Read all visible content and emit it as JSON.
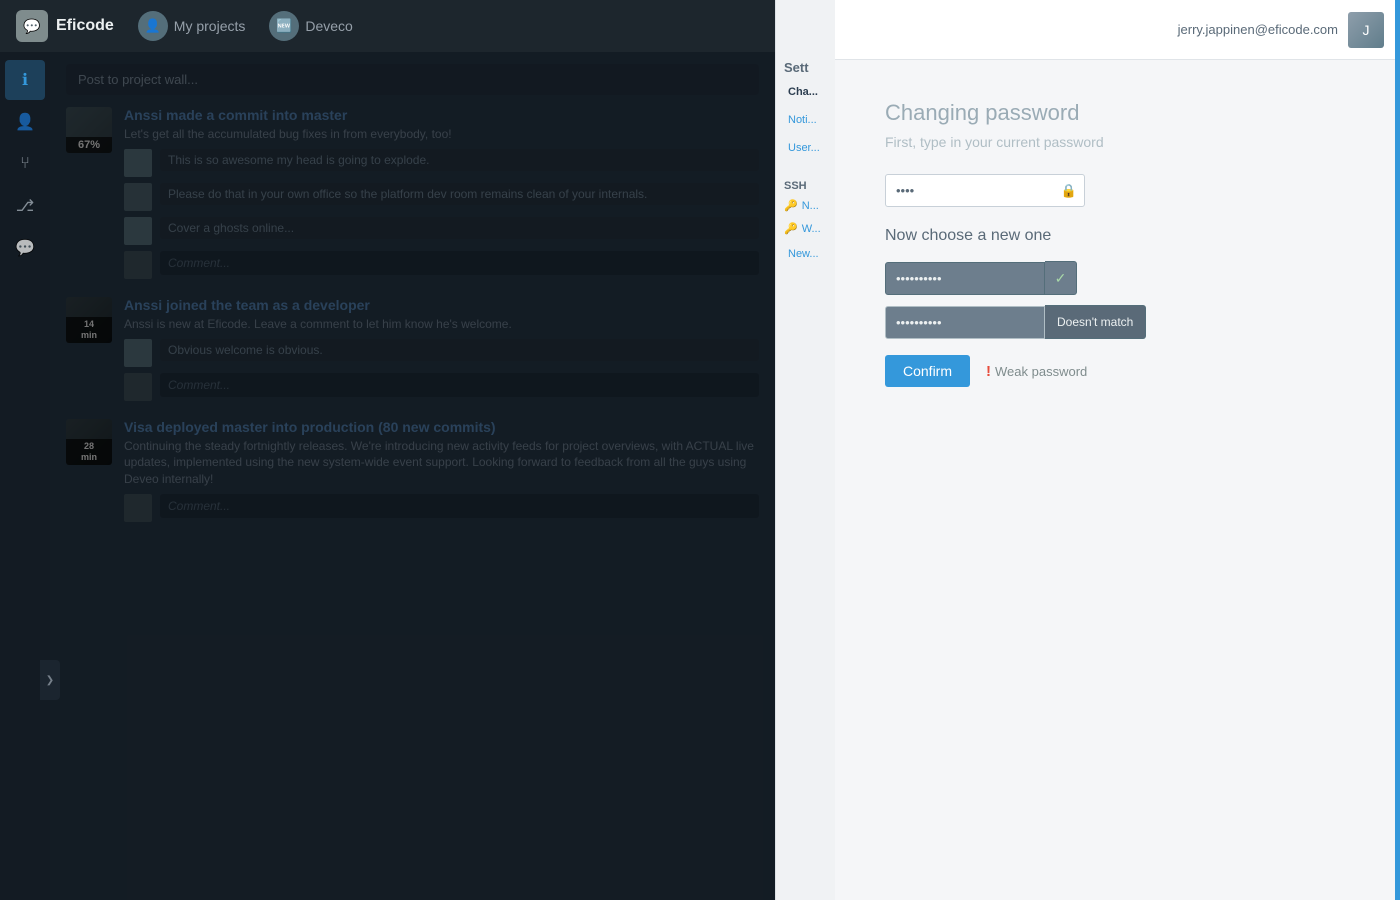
{
  "app": {
    "name": "Eficode",
    "nav": {
      "logo_icon": "💬",
      "items": [
        {
          "label": "My projects",
          "icon": "👤"
        },
        {
          "label": "Deveco",
          "icon": "🆕"
        }
      ]
    }
  },
  "sidebar": {
    "items": [
      {
        "label": "info",
        "icon": "ℹ",
        "active": true
      },
      {
        "label": "user",
        "icon": "👤"
      },
      {
        "label": "branch",
        "icon": "⑂"
      },
      {
        "label": "git",
        "icon": "⎇"
      },
      {
        "label": "chat",
        "icon": "💬"
      }
    ],
    "toggle_icon": "❯"
  },
  "activities": [
    {
      "id": 1,
      "title": "Anssi made a commit into master",
      "desc": "Let's get all the accumulated bug fixes in from everybody, too!",
      "time": "67%",
      "comments": [
        {
          "text": "This is so awesome my head is going to explode."
        },
        {
          "text": "Please do that in your own office so the platform dev room remains clean of your internals."
        },
        {
          "text": "Cover a ghosts online..."
        }
      ],
      "comment_placeholder": "Comment..."
    },
    {
      "id": 2,
      "title": "Anssi joined the team as a developer",
      "desc": "Anssi is new at Eficode. Leave a comment to let him know he's welcome.",
      "time": "14\nmin",
      "comments": [
        {
          "text": "Obvious welcome is obvious."
        }
      ],
      "comment_placeholder": "Comment..."
    },
    {
      "id": 3,
      "title": "Visa deployed master into production (80 new commits)",
      "desc": "Continuing the steady fortnightly releases. We're introducing new activity feeds for project overviews, with ACTUAL live updates, implemented using the new system-wide event support. Looking forward to feedback from all the guys using Deveo internally!",
      "time": "28\nmin",
      "comments": [],
      "comment_placeholder": "Comment..."
    }
  ],
  "settings": {
    "header": "Sett",
    "nav_items": [
      {
        "label": "Cha...",
        "active": true
      },
      {
        "label": "Noti..."
      },
      {
        "label": "User..."
      }
    ],
    "ssh_label": "SSH",
    "ssh_items": [
      {
        "label": "N..."
      },
      {
        "label": "W..."
      }
    ],
    "new_link": "New..."
  },
  "right_panel": {
    "user_email": "jerry.jappinen@eficode.com",
    "user_avatar_letter": "J",
    "change_password": {
      "title": "Changing password",
      "subtitle": "First, type in your current password",
      "current_password_placeholder": "••••",
      "current_password_value": "••••",
      "lock_icon": "🔒",
      "section_new_label": "Now choose a new one",
      "new_password_dots": "••••••••••",
      "new_password_check": "✓",
      "confirm_password_dots": "••••••••••",
      "doesnt_match_label": "Doesn't match",
      "confirm_button_label": "Confirm",
      "weak_password_icon": "!",
      "weak_password_label": "Weak password"
    }
  }
}
